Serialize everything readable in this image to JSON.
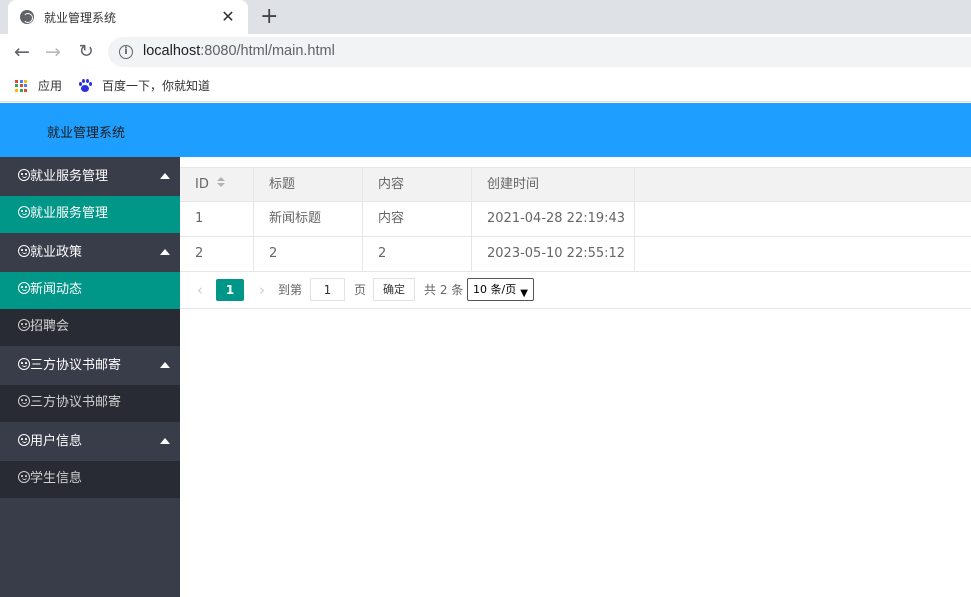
{
  "browser": {
    "tab_title": "就业管理系统",
    "url_host": "localhost",
    "url_rest": ":8080/html/main.html",
    "bookmarks": [
      {
        "label": "应用",
        "icon": "apps-grid-icon"
      },
      {
        "label": "百度一下，你就知道",
        "icon": "baidu-paw-icon"
      }
    ]
  },
  "header": {
    "title": "就业管理系统"
  },
  "sidebar": {
    "groups": [
      {
        "label": "就业服务管理",
        "items": [
          {
            "label": "就业服务管理",
            "active": true
          }
        ]
      },
      {
        "label": "就业政策",
        "items": [
          {
            "label": "新闻动态",
            "active": true
          },
          {
            "label": "招聘会",
            "active": false
          }
        ]
      },
      {
        "label": "三方协议书邮寄",
        "items": [
          {
            "label": "三方协议书邮寄",
            "active": false
          }
        ]
      },
      {
        "label": "用户信息",
        "items": [
          {
            "label": "学生信息",
            "active": false
          }
        ]
      }
    ],
    "icon": "smile-icon"
  },
  "table": {
    "columns": [
      "ID",
      "标题",
      "内容",
      "创建时间"
    ],
    "rows": [
      [
        "1",
        "新闻标题",
        "内容",
        "2021-04-28 22:19:43"
      ],
      [
        "2",
        "2",
        "2",
        "2023-05-10 22:55:12"
      ]
    ]
  },
  "pager": {
    "current_page": "1",
    "goto_label": "到第",
    "goto_value": "1",
    "page_unit": "页",
    "confirm_label": "确定",
    "total_label": "共 2 条",
    "page_size": "10 条/页"
  },
  "colors": {
    "header": "#1e9fff",
    "sidebar": "#393d49",
    "active": "#009688"
  }
}
